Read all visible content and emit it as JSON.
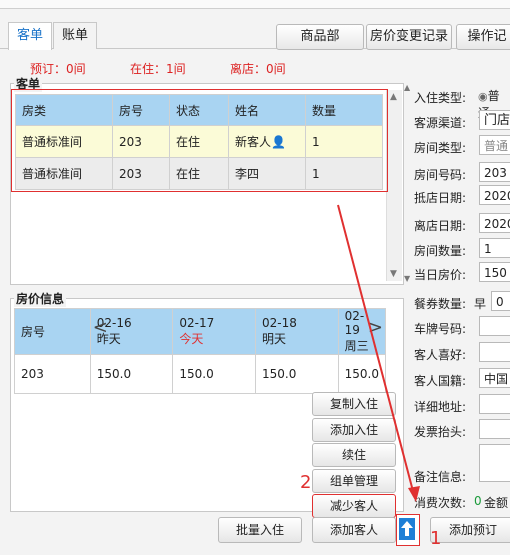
{
  "tabs": [
    "客单",
    "账单"
  ],
  "toolbar": {
    "goods": "商品部",
    "price_log": "房价变更记录",
    "operation": "操作记"
  },
  "status": {
    "reserved": "预订：0间",
    "checked_in": "在住：1间",
    "left": "离店：0间"
  },
  "guest_section": {
    "title": "客单",
    "columns": [
      "房类",
      "房号",
      "状态",
      "姓名",
      "数量"
    ],
    "rows": [
      {
        "room_type": "普通标准间",
        "room_no": "203",
        "status": "在住",
        "name": "新客人",
        "qty": "1"
      },
      {
        "room_type": "普通标准间",
        "room_no": "203",
        "status": "在住",
        "name": "李四",
        "qty": "1"
      }
    ]
  },
  "price_section": {
    "title": "房价信息",
    "room_col": "房号",
    "prev_glyph": "<",
    "next_glyph": ">",
    "dates": [
      {
        "date": "02-16",
        "day": "昨天",
        "today": false
      },
      {
        "date": "02-17",
        "day": "今天",
        "today": true
      },
      {
        "date": "02-18",
        "day": "明天",
        "today": false
      },
      {
        "date": "02-19",
        "day": "周三",
        "today": false
      }
    ],
    "row": {
      "room": "203",
      "prices": [
        "150.0",
        "150.0",
        "150.0",
        "150.0"
      ]
    }
  },
  "side_buttons": [
    "复制入住",
    "添加入住",
    "续住",
    "组单管理",
    "减少客人"
  ],
  "bottom_buttons": {
    "batch": "批量入住",
    "add_guest": "添加客人",
    "add_booking": "添加预订"
  },
  "form": {
    "checkin_type": {
      "label": "入住类型:",
      "option": "普通"
    },
    "source": {
      "label": "客源渠道:",
      "value": "门店"
    },
    "room_type": {
      "label": "房间类型:",
      "value": "普通"
    },
    "room_no": {
      "label": "房间号码:",
      "value": "203"
    },
    "arrive": {
      "label": "抵店日期:",
      "value": "2020"
    },
    "depart": {
      "label": "离店日期:",
      "value": "2020"
    },
    "room_count": {
      "label": "房间数量:",
      "value": "1"
    },
    "day_price": {
      "label": "当日房价:",
      "value": "150"
    },
    "meal": {
      "label": "餐券数量:",
      "sub": "早",
      "value": "0"
    },
    "plate": {
      "label": "车牌号码:",
      "value": ""
    },
    "preference": {
      "label": "客人喜好:",
      "value": ""
    },
    "nationality": {
      "label": "客人国籍:",
      "value": "中国"
    },
    "address": {
      "label": "详细地址:",
      "value": ""
    },
    "invoice": {
      "label": "发票抬头:",
      "value": ""
    },
    "remark": {
      "label": "备注信息:",
      "value": ""
    },
    "consume": {
      "label": "消费次数:",
      "count": "0",
      "amount_label": "金额"
    }
  },
  "annotations": {
    "step1": "1",
    "step2": "2"
  },
  "colors": {
    "header_blue": "#a9d4f2",
    "highlight": "#e03030",
    "today": "#e03030"
  }
}
